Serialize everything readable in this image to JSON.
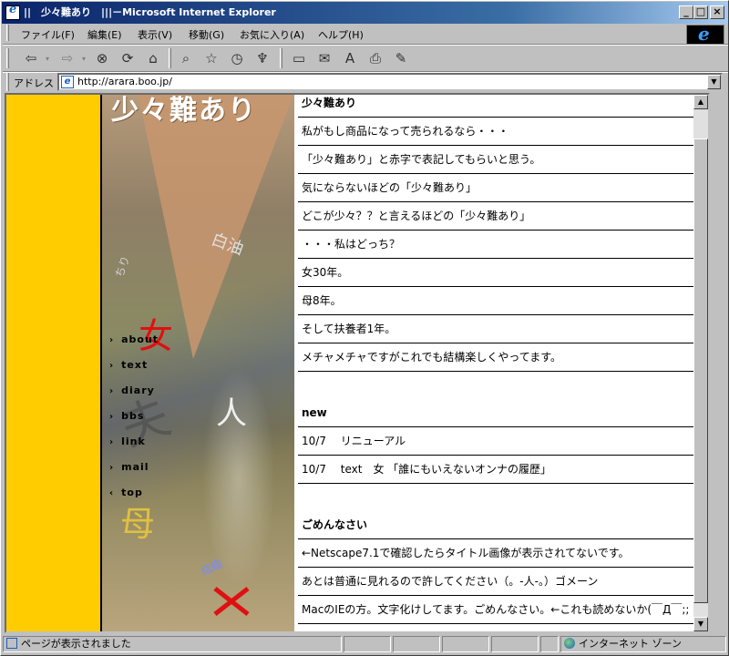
{
  "window": {
    "title": "||　少々難あり　|||－Microsoft Internet Explorer",
    "controls": {
      "minimize": "_",
      "maximize": "□",
      "close": "×"
    }
  },
  "menu": [
    "ファイル(F)",
    "編集(E)",
    "表示(V)",
    "移動(G)",
    "お気に入り(A)",
    "ヘルプ(H)"
  ],
  "toolbar": {
    "icons": [
      "back-icon",
      "forward-icon",
      "stop-icon",
      "refresh-icon",
      "home-icon",
      "search-icon",
      "favorites-icon",
      "history-icon",
      "channels-icon",
      "fullscreen-icon",
      "mail-icon",
      "font-icon",
      "print-icon",
      "edit-icon"
    ]
  },
  "address": {
    "label": "アドレス",
    "url": "http://arara.boo.jp/"
  },
  "page": {
    "brand": "少々難あり",
    "photo_words": [
      "白油",
      "ちり",
      "女",
      "夫",
      "人",
      "母",
      "結婚"
    ],
    "nav": [
      {
        "label": "about",
        "arrow": "›"
      },
      {
        "label": "text",
        "arrow": "›"
      },
      {
        "label": "diary",
        "arrow": "›"
      },
      {
        "label": "bbs",
        "arrow": "›"
      },
      {
        "label": "link",
        "arrow": "›"
      },
      {
        "label": "mail",
        "arrow": "›"
      },
      {
        "label": "top",
        "arrow": "‹"
      }
    ],
    "rows": [
      {
        "text": "少々難あり",
        "style": "head"
      },
      {
        "text": "私がもし商品になって売られるなら・・・"
      },
      {
        "text": "「少々難あり」と赤字で表記してもらいと思う。"
      },
      {
        "text": "気にならないほどの「少々難あり」"
      },
      {
        "text": "どこが少々？？と言えるほどの「少々難あり」"
      },
      {
        "text": "・・・私はどっち？"
      },
      {
        "text": "女30年。"
      },
      {
        "text": "母8年。"
      },
      {
        "text": "そして扶養者1年。"
      },
      {
        "text": "メチャメチャですがこれでも結構楽しくやってます。"
      },
      {
        "text": "",
        "style": "blank"
      },
      {
        "text": "new",
        "style": "head"
      },
      {
        "text": "10/7　 リニューアル"
      },
      {
        "text": "10/7　 text　女 「誰にもいえないオンナの履歴」"
      },
      {
        "text": "",
        "style": "blank"
      },
      {
        "text": "ごめんなさい",
        "style": "head"
      },
      {
        "text": "←Netscape7.1で確認したらタイトル画像が表示されてないです。"
      },
      {
        "text": "あとは普通に見れるので許してください（。-人-。）ゴメーン"
      },
      {
        "text": "MacのIEの方。文字化けしてます。ごめんなさい。←これも読めないか(￣Д￣;;"
      }
    ]
  },
  "status": {
    "message": "ページが表示されました",
    "zone": "インターネット ゾーン"
  }
}
